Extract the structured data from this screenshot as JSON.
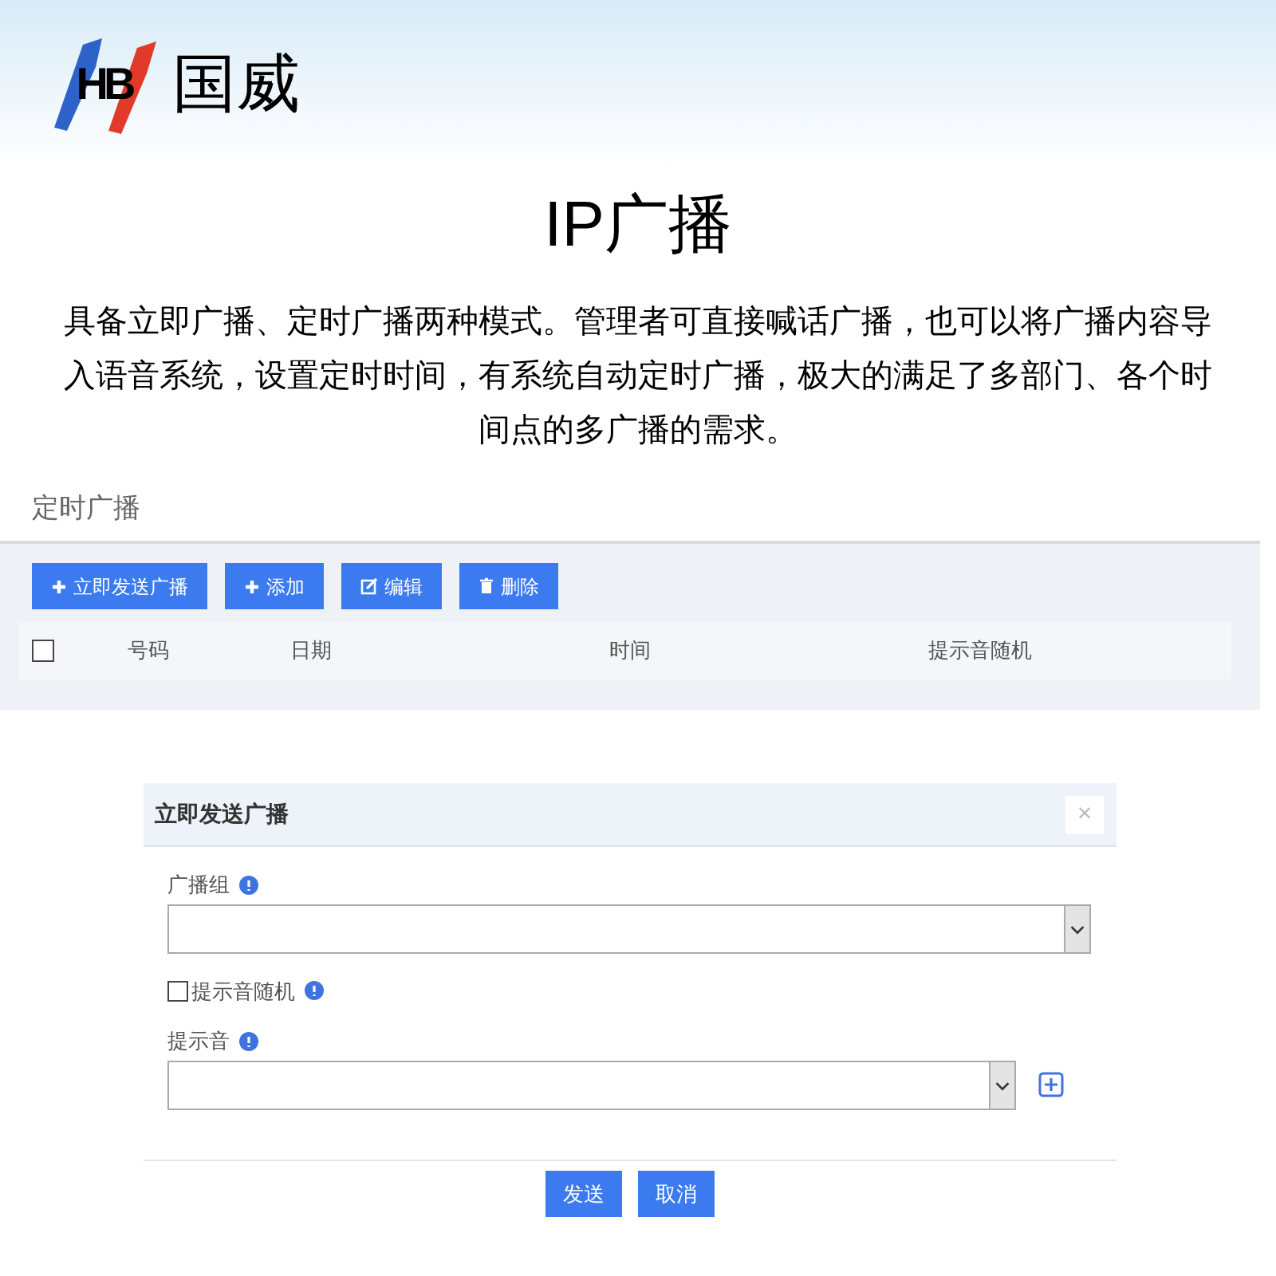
{
  "logo": {
    "mark": "HB",
    "name": "国威"
  },
  "title": "IP广播",
  "description": "具备立即广播、定时广播两种模式。管理者可直接喊话广播，也可以将广播内容导入语音系统，设置定时时间，有系统自动定时广播，极大的满足了多部门、各个时间点的多广播的需求。",
  "panel": {
    "title": "定时广播",
    "toolbar": [
      {
        "label": "立即发送广播"
      },
      {
        "label": "添加"
      },
      {
        "label": "编辑"
      },
      {
        "label": "删除"
      }
    ],
    "table": {
      "select_all": {
        "checked": false
      },
      "columns": [
        "号码",
        "日期",
        "时间",
        "提示音随机"
      ]
    }
  },
  "dialog": {
    "title": "立即发送广播",
    "close": "×",
    "fields": [
      {
        "kind": "select",
        "label": "广播组",
        "add": false
      },
      {
        "kind": "checkbox",
        "label": "提示音随机",
        "checked": false
      },
      {
        "kind": "select",
        "label": "提示音",
        "add": true
      }
    ],
    "buttons": [
      "发送",
      "取消"
    ]
  }
}
